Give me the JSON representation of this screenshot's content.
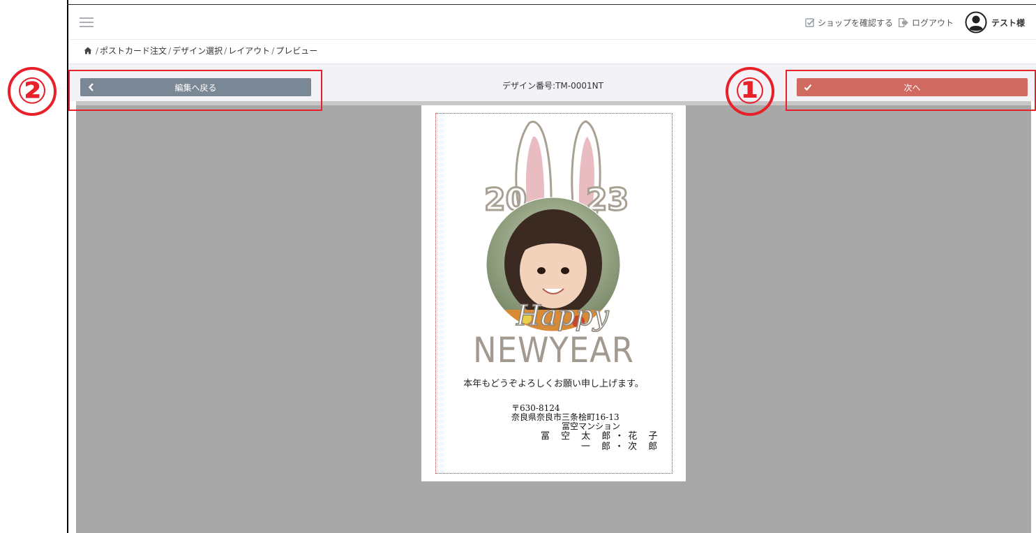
{
  "topbar": {
    "shop_confirm": "ショップを確認する",
    "logout": "ログアウト",
    "user_name": "テスト様"
  },
  "breadcrumb": [
    "ポストカード注文",
    "デザイン選択",
    "レイアウト",
    "プレビュー"
  ],
  "toolbar": {
    "back_label": "編集へ戻る",
    "design_number": "デザイン番号:TM-0001NT",
    "next_label": "次へ"
  },
  "markers": {
    "one": "①",
    "two": "②"
  },
  "card": {
    "year_left": "20",
    "year_right": "23",
    "happy": "Happy",
    "new_year": "NEWYEAR",
    "greeting": "本年もどうぞよろしくお願い申し上げます。",
    "postal": "〒630-8124",
    "address": "奈良県奈良市三条桧町16-13",
    "building": "冨空マンション",
    "names_line1": "冨 空 太 郎・花 子",
    "names_line2": "一 郎・次 郎"
  },
  "colors": {
    "back_button": "#7a8795",
    "next_button": "#d0695f",
    "highlight": "#e8202a",
    "canvas": "#a8a8a8"
  },
  "icons": [
    "hamburger-icon",
    "check-square-icon",
    "logout-icon",
    "user-avatar-icon",
    "home-icon",
    "chevron-left-icon",
    "checkmark-icon"
  ]
}
